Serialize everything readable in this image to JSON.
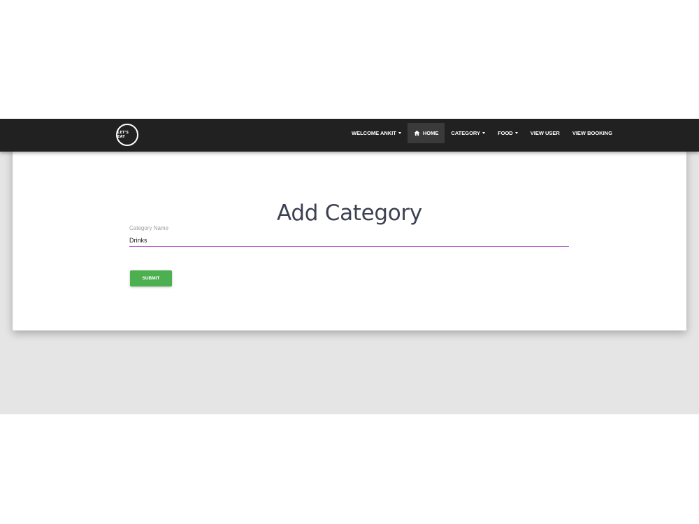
{
  "navbar": {
    "logo_text": "LET'S EAT",
    "items": [
      {
        "label": "WELCOME ANKIT",
        "dropdown": true
      },
      {
        "label": "HOME",
        "active": true,
        "icon": "home-icon"
      },
      {
        "label": "CATEGORY",
        "dropdown": true
      },
      {
        "label": "FOOD",
        "dropdown": true
      },
      {
        "label": "VIEW USER"
      },
      {
        "label": "VIEW BOOKING"
      }
    ]
  },
  "form": {
    "title": "Add Category",
    "category_label": "Category Name",
    "category_value": "Drinks",
    "submit_label": "SUBMIT"
  },
  "colors": {
    "navbar_bg": "#212121",
    "submit_bg": "#4caf50",
    "input_underline": "#9c27b0"
  }
}
